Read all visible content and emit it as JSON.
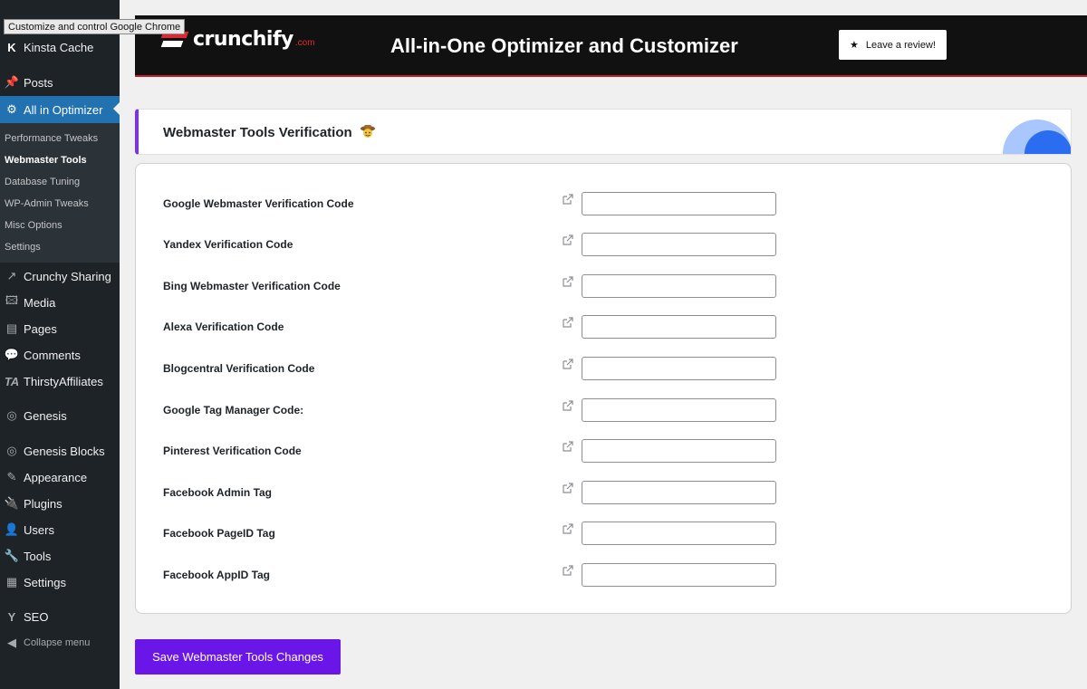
{
  "tooltip": "Customize and control Google Chrome",
  "sidebar": {
    "items": [
      {
        "id": "kinsta-cache",
        "icon": "K",
        "label": "Kinsta Cache"
      },
      {
        "id": "posts",
        "icon": "📌",
        "label": "Posts"
      },
      {
        "id": "all-in-optimizer",
        "icon": "⚙",
        "label": "All in Optimizer"
      },
      {
        "id": "crunchy-sharing",
        "icon": "↗",
        "label": "Crunchy Sharing"
      },
      {
        "id": "media",
        "icon": "🖾",
        "label": "Media"
      },
      {
        "id": "pages",
        "icon": "▤",
        "label": "Pages"
      },
      {
        "id": "comments",
        "icon": "💬",
        "label": "Comments"
      },
      {
        "id": "thirstyaffiliates",
        "icon": "TA",
        "label": "ThirstyAffiliates"
      },
      {
        "id": "genesis",
        "icon": "◎",
        "label": "Genesis"
      },
      {
        "id": "genesis-blocks",
        "icon": "◎",
        "label": "Genesis Blocks"
      },
      {
        "id": "appearance",
        "icon": "✎",
        "label": "Appearance"
      },
      {
        "id": "plugins",
        "icon": "🔌",
        "label": "Plugins"
      },
      {
        "id": "users",
        "icon": "👤",
        "label": "Users"
      },
      {
        "id": "tools",
        "icon": "🔧",
        "label": "Tools"
      },
      {
        "id": "settings",
        "icon": "▦",
        "label": "Settings"
      },
      {
        "id": "seo",
        "icon": "Y",
        "label": "SEO"
      }
    ],
    "submenu": [
      {
        "label": "Performance Tweaks"
      },
      {
        "label": "Webmaster Tools"
      },
      {
        "label": "Database Tuning"
      },
      {
        "label": "WP-Admin Tweaks"
      },
      {
        "label": "Misc Options"
      },
      {
        "label": "Settings"
      }
    ],
    "collapse_label": "Collapse menu"
  },
  "banner": {
    "logo_text": "crunchify",
    "logo_suffix": ".com",
    "title": "All-in-One Optimizer and Customizer",
    "review_label": "Leave a review!"
  },
  "section": {
    "title": "Webmaster Tools Verification",
    "emoji": "cowboy-emoji"
  },
  "fields": [
    {
      "label": "Google Webmaster Verification Code",
      "value": ""
    },
    {
      "label": "Yandex Verification Code",
      "value": ""
    },
    {
      "label": "Bing Webmaster Verification Code",
      "value": ""
    },
    {
      "label": "Alexa Verification Code",
      "value": ""
    },
    {
      "label": "Blogcentral Verification Code",
      "value": ""
    },
    {
      "label": "Google Tag Manager Code:",
      "value": ""
    },
    {
      "label": "Pinterest Verification Code",
      "value": ""
    },
    {
      "label": "Facebook Admin Tag",
      "value": ""
    },
    {
      "label": "Facebook PageID Tag",
      "value": ""
    },
    {
      "label": "Facebook AppID Tag",
      "value": ""
    }
  ],
  "save_label": "Save Webmaster Tools Changes",
  "colors": {
    "sidebar_bg": "#1d2327",
    "active_bg": "#2271b1",
    "accent_purple": "#6a16e8",
    "brand_red": "#e02834"
  }
}
